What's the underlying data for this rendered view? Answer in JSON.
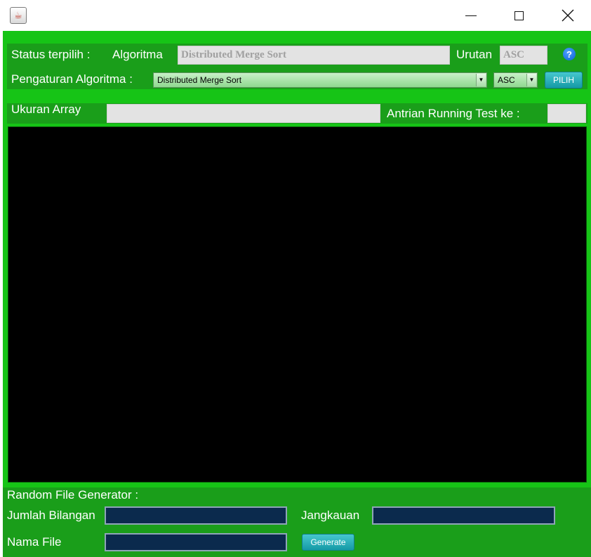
{
  "window": {
    "icon": "java-cup-icon",
    "controls": [
      "minimize-icon",
      "maximize-icon",
      "close-icon"
    ]
  },
  "status": {
    "label": "Status terpilih :",
    "algorithm_label": "Algoritma",
    "algorithm_value": "Distributed Merge Sort",
    "order_label": "Urutan",
    "order_value": "ASC",
    "help": "?"
  },
  "settings": {
    "label": "Pengaturan Algoritma :",
    "algorithm_selected": "Distributed Merge Sort",
    "order_selected": "ASC",
    "select_button": "PILIH"
  },
  "array": {
    "size_label": "Ukuran Array",
    "size_value": "",
    "queue_label": "Antrian Running Test ke :",
    "queue_value": ""
  },
  "generator": {
    "title": "Random File Generator :",
    "count_label": "Jumlah Bilangan",
    "count_value": "",
    "range_label": "Jangkauan",
    "range_value": "",
    "filename_label": "Nama File",
    "filename_value": "",
    "generate_button": "Generate"
  },
  "colors": {
    "frame": "#16c416",
    "panel": "#1a9e1a",
    "output_bg": "#000000",
    "button_teal": "#1aa5b0",
    "dark_input": "#0b2a4d"
  }
}
